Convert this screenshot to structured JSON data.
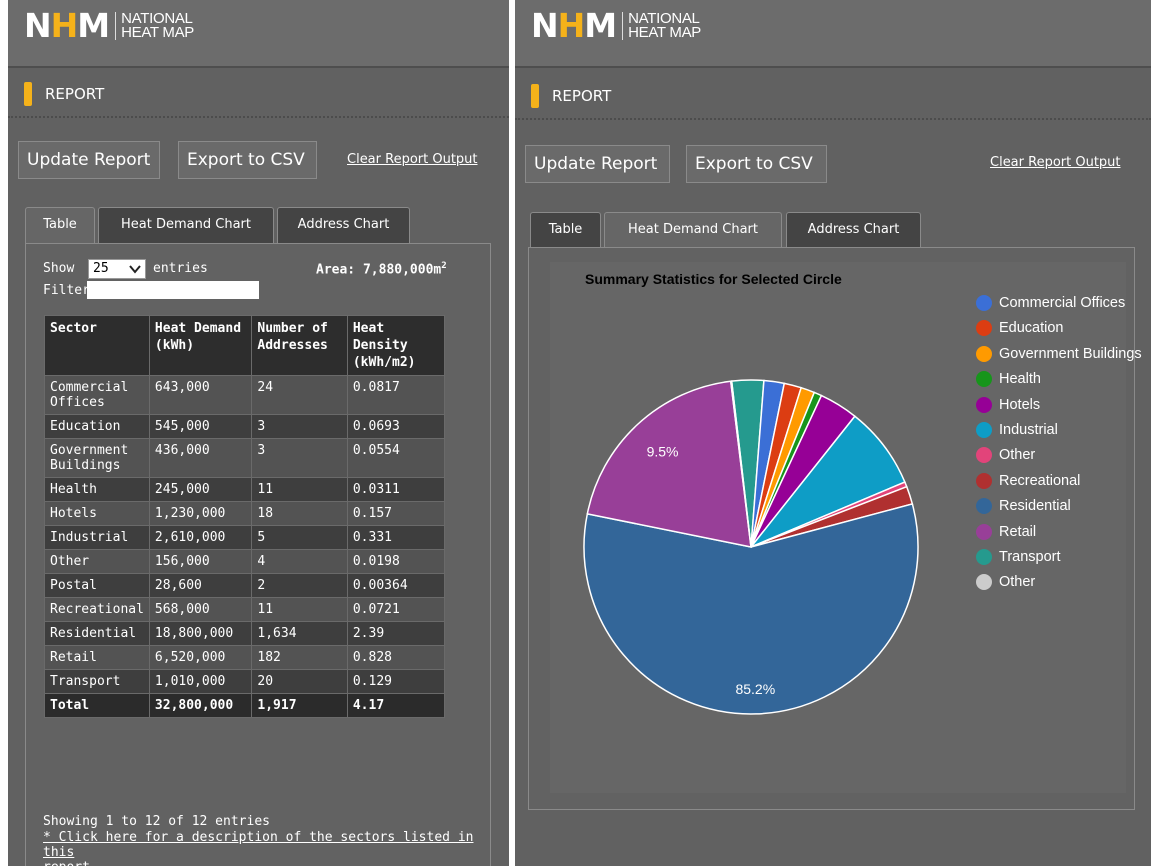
{
  "brand": {
    "logo_letters_left": "N",
    "logo_letter_h": "H",
    "logo_letters_right": "M",
    "line1": "NATIONAL",
    "line2": "HEAT MAP",
    "accent_color": "#f5b21a"
  },
  "report": {
    "section_title": "REPORT",
    "update_button": "Update Report",
    "export_button": "Export to CSV",
    "clear_link": "Clear Report Output",
    "tabs": [
      "Table",
      "Heat Demand Chart",
      "Address Chart"
    ]
  },
  "table_view": {
    "show_label": "Show",
    "show_value": "25",
    "entries_label": "entries",
    "filter_label": "Filter",
    "filter_value": "",
    "area_label": "Area: 7,880,000m",
    "area_sup": "2",
    "columns": [
      "Sector",
      "Heat Demand (kWh)",
      "Number of Addresses",
      "Heat Density (kWh/m2)"
    ],
    "rows": [
      [
        "Commercial Offices",
        "643,000",
        "24",
        "0.0817"
      ],
      [
        "Education",
        "545,000",
        "3",
        "0.0693"
      ],
      [
        "Government Buildings",
        "436,000",
        "3",
        "0.0554"
      ],
      [
        "Health",
        "245,000",
        "11",
        "0.0311"
      ],
      [
        "Hotels",
        "1,230,000",
        "18",
        "0.157"
      ],
      [
        "Industrial",
        "2,610,000",
        "5",
        "0.331"
      ],
      [
        "Other",
        "156,000",
        "4",
        "0.0198"
      ],
      [
        "Postal",
        "28,600",
        "2",
        "0.00364"
      ],
      [
        "Recreational",
        "568,000",
        "11",
        "0.0721"
      ],
      [
        "Residential",
        "18,800,000",
        "1,634",
        "2.39"
      ],
      [
        "Retail",
        "6,520,000",
        "182",
        "0.828"
      ],
      [
        "Transport",
        "1,010,000",
        "20",
        "0.129"
      ]
    ],
    "total": [
      "Total",
      "32,800,000",
      "1,917",
      "4.17"
    ],
    "showing_text": "Showing 1 to 12 of 12 entries",
    "description_link_1": "* Click here for a description of the sectors listed in this",
    "description_link_2": "report"
  },
  "chart_data": {
    "type": "pie",
    "title": "Summary Statistics for Selected Circle",
    "series": [
      {
        "name": "Commercial Offices",
        "value": 643000,
        "color": "#3b6fd6"
      },
      {
        "name": "Education",
        "value": 545000,
        "color": "#dc3d12"
      },
      {
        "name": "Government Buildings",
        "value": 436000,
        "color": "#ff9a00"
      },
      {
        "name": "Health",
        "value": 245000,
        "color": "#17951b"
      },
      {
        "name": "Hotels",
        "value": 1230000,
        "color": "#960096"
      },
      {
        "name": "Industrial",
        "value": 2610000,
        "color": "#0e9dc6"
      },
      {
        "name": "Other",
        "value": 156000,
        "color": "#e2447a"
      },
      {
        "name": "Recreational",
        "value": 568000,
        "color": "#b03030"
      },
      {
        "name": "Residential",
        "value": 18800000,
        "color": "#336699"
      },
      {
        "name": "Retail",
        "value": 6520000,
        "color": "#983f98"
      },
      {
        "name": "Transport",
        "value": 1010000,
        "color": "#259a8e"
      },
      {
        "name": "Other",
        "value": 28600,
        "color": "#cccccc"
      }
    ],
    "visible_labels": [
      {
        "series_index": 9,
        "text": "9.5%"
      },
      {
        "series_index": 8,
        "text": "85.2%"
      }
    ],
    "legend_position": "right"
  }
}
